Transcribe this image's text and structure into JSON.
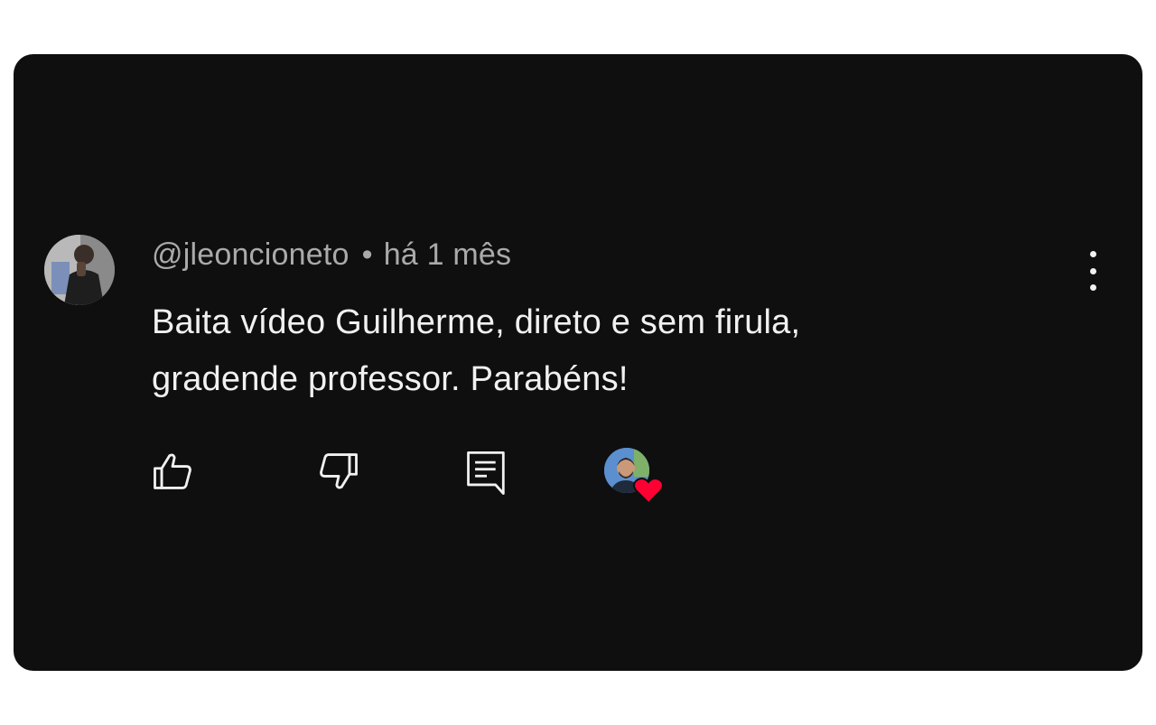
{
  "comment": {
    "username": "@jleoncioneto",
    "separator": "•",
    "time": "há 1 mês",
    "text_line1": "Baita vídeo Guilherme, direto e sem firula,",
    "text_line2": "gradende professor. Parabéns!"
  },
  "icons": {
    "menu": "more-vertical-icon",
    "like": "thumbs-up-icon",
    "dislike": "thumbs-down-icon",
    "reply": "reply-comment-icon",
    "creator_heart": "creator-heart-icon"
  },
  "colors": {
    "background": "#0f0f0f",
    "text_primary": "#f1f1f1",
    "text_secondary": "#aaaaaa",
    "heart": "#ff0033"
  }
}
